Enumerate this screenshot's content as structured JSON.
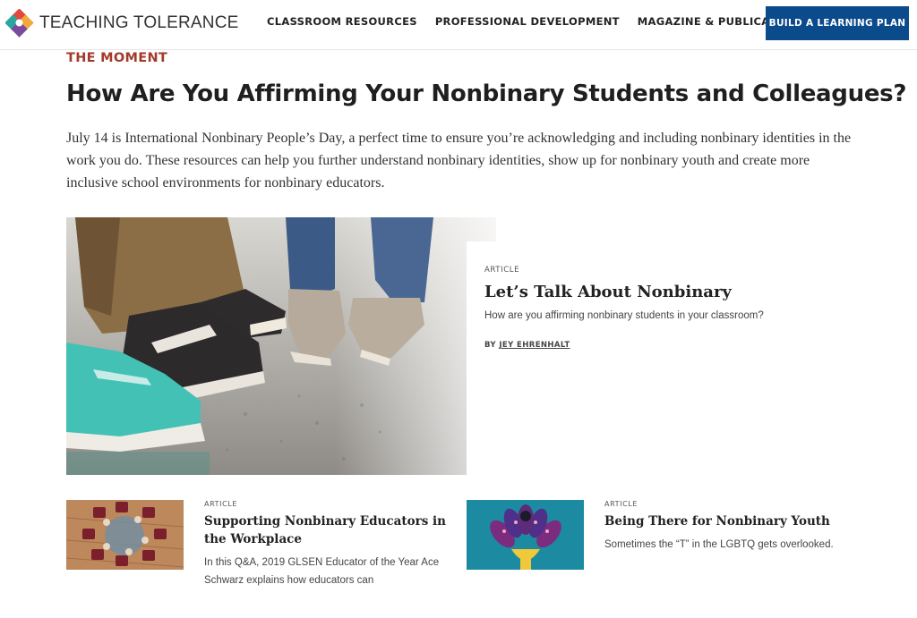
{
  "header": {
    "logo_text": "TEACHING TOLERANCE",
    "nav": [
      "CLASSROOM RESOURCES",
      "PROFESSIONAL DEVELOPMENT",
      "MAGAZINE & PUBLICATIONS"
    ],
    "cta": "BUILD A LEARNING PLAN",
    "colors": {
      "cta_bg": "#0b4a8b",
      "eyebrow": "#a33a2a"
    }
  },
  "hero": {
    "eyebrow": "THE MOMENT",
    "title": "How Are You Affirming Your Nonbinary Students and Colleagues?",
    "intro": "July 14 is International Nonbinary People’s Day, a perfect time to ensure you’re acknowledging and including nonbinary identities in the work you do. These resources can help you further understand nonbinary identities, show up for nonbinary youth and create more inclusive school environments for nonbinary educators."
  },
  "feature": {
    "kicker": "ARTICLE",
    "title": "Let’s Talk About Nonbinary",
    "description": "How are you affirming nonbinary students in your classroom?",
    "by_label": "BY",
    "author": "JEY EHRENHALT",
    "image_icon": "sneakers-photo"
  },
  "cards": [
    {
      "kicker": "ARTICLE",
      "title": "Supporting Nonbinary Educators in the Workplace",
      "description": "In this Q&A, 2019 GLSEN Educator of the Year Ace Schwarz explains how educators can",
      "image_icon": "chairs-circle-photo"
    },
    {
      "kicker": "ARTICLE",
      "title": "Being There for Nonbinary Youth",
      "description": "Sometimes the “T” in the LGBTQ gets overlooked.",
      "image_icon": "flower-illustration"
    }
  ]
}
